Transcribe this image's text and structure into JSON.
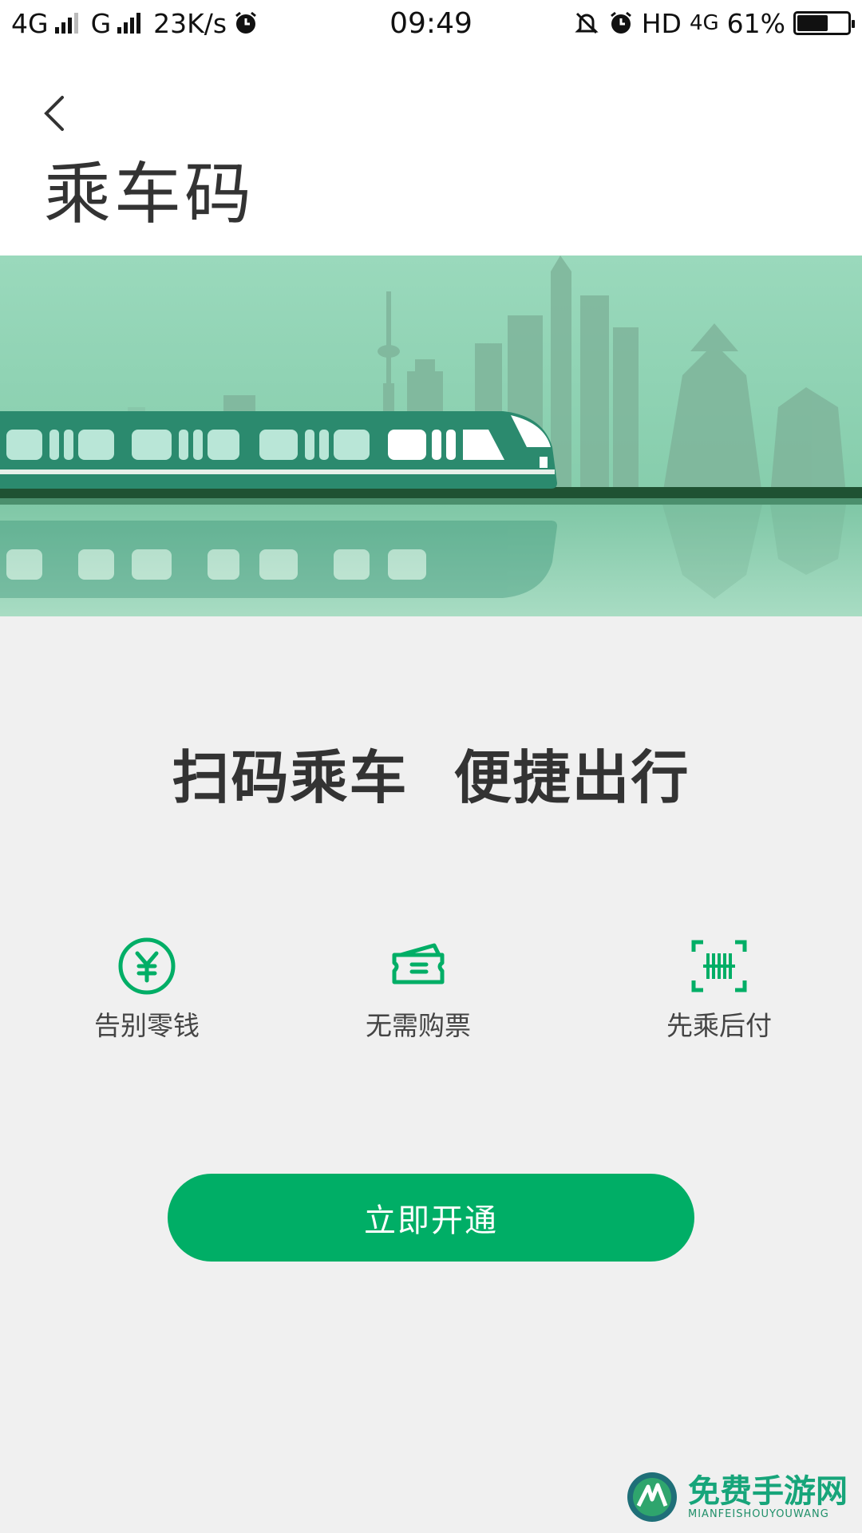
{
  "status_bar": {
    "net1": "4G",
    "net2": "G",
    "speed": "23K/s",
    "time": "09:49",
    "hd": "HD",
    "net3": "4G",
    "battery": "61%",
    "battery_level": 0.61
  },
  "header": {
    "title": "乘车码"
  },
  "banner": {
    "icon": "city-train-illustration"
  },
  "main": {
    "slogan": "扫码乘车 便捷出行",
    "features": [
      {
        "label": "告别零钱",
        "icon": "yuan-coin-icon"
      },
      {
        "label": "无需购票",
        "icon": "ticket-icon"
      },
      {
        "label": "先乘后付",
        "icon": "barcode-scan-icon"
      }
    ],
    "open_button": "立即开通"
  },
  "watermark": {
    "cn": "免费手游网",
    "en": "MIANFEISHOUYOUWANG"
  },
  "colors": {
    "accent": "#00ae66",
    "banner_bg": "#8fd2b3",
    "train": "#2b8a6e"
  }
}
